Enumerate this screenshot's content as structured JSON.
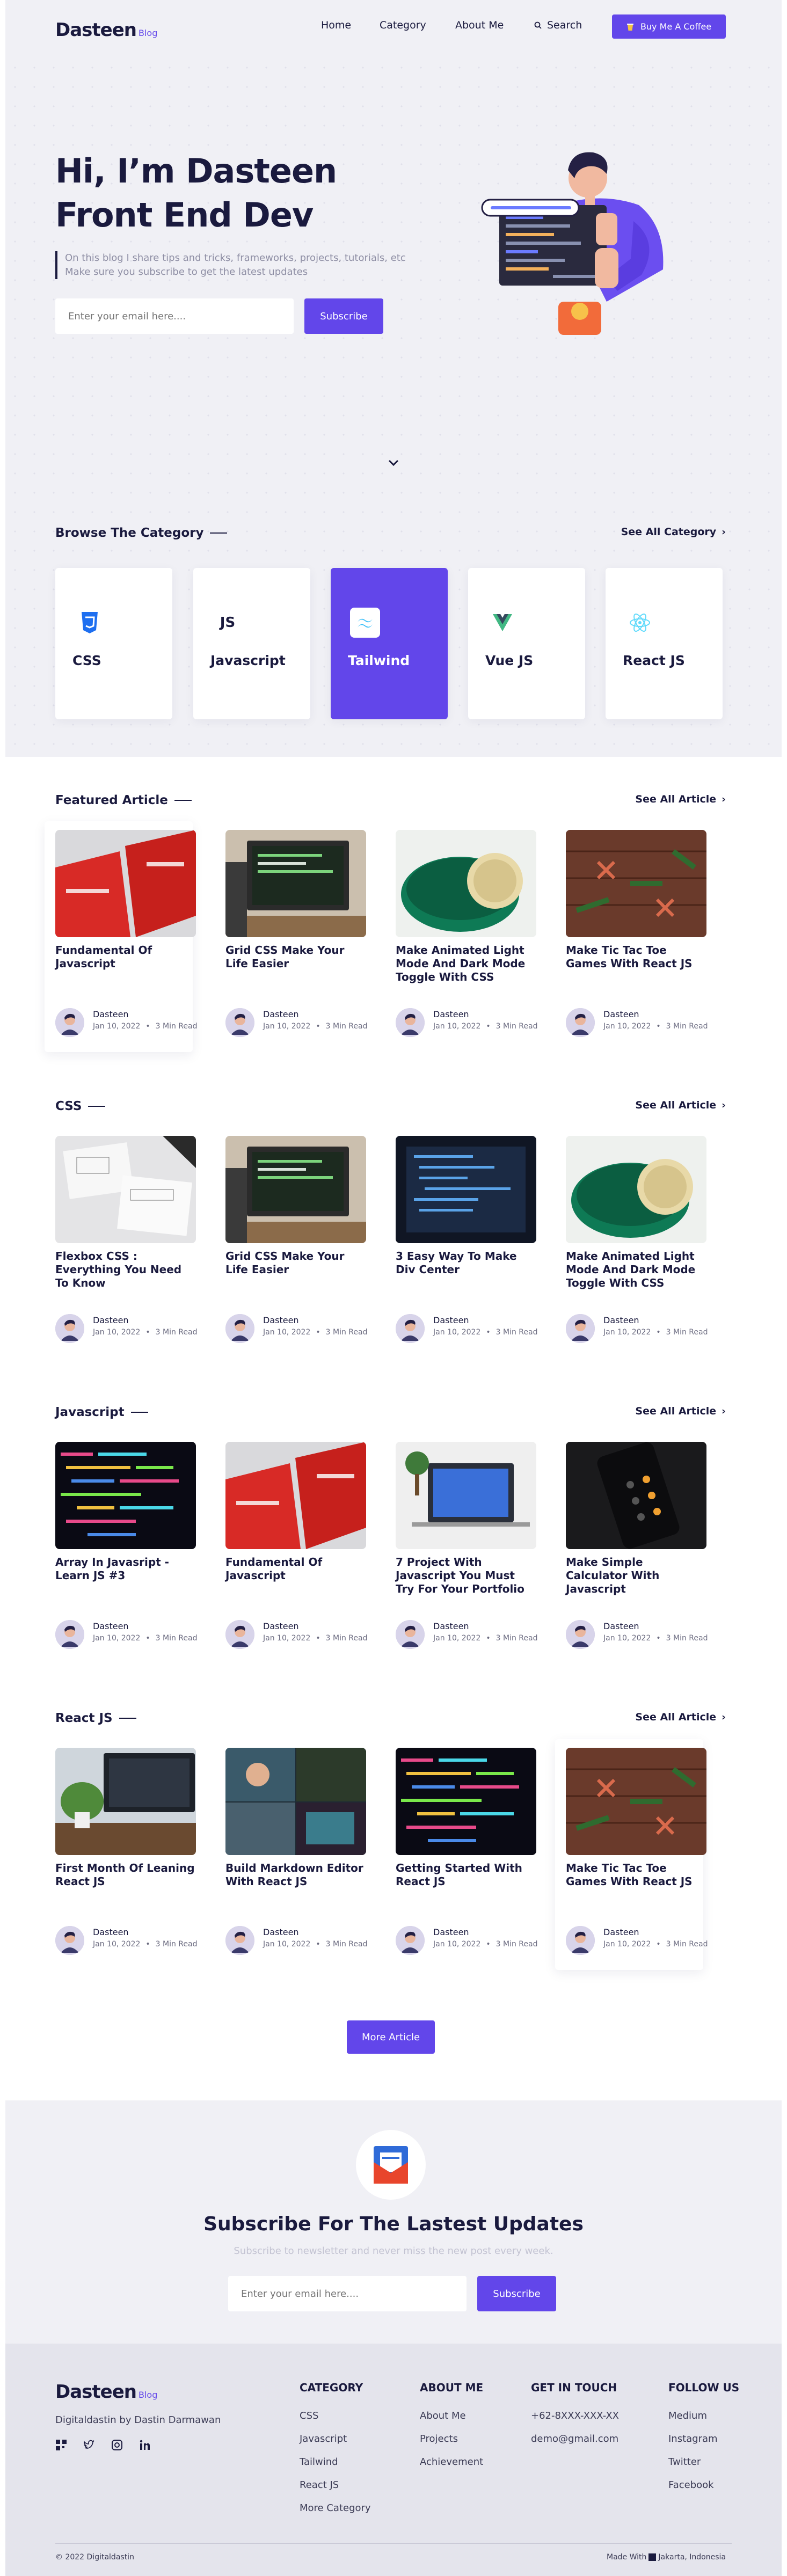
{
  "nav": {
    "logo": "Dasteen",
    "logo_sub": "Blog",
    "home": "Home",
    "category": "Category",
    "about": "About Me",
    "search": "Search",
    "coffee": "Buy Me A Coffee"
  },
  "hero": {
    "line1": "Hi, I’m Dasteen",
    "line2": "Front End Dev",
    "desc1": "On this blog I share tips and tricks, frameworks, projects, tutorials, etc",
    "desc2": "Make sure you subscribe to get the latest updates",
    "email_placeholder": "Enter your email here....",
    "subscribe": "Subscribe"
  },
  "category": {
    "title": "Browse The Category",
    "see_all": "See All Category",
    "items": [
      {
        "label": "CSS",
        "icon": "css3-icon"
      },
      {
        "label": "Javascript",
        "icon": "js-icon"
      },
      {
        "label": "Tailwind",
        "icon": "tailwind-icon",
        "active": true
      },
      {
        "label": "Vue JS",
        "icon": "vue-icon"
      },
      {
        "label": "React JS",
        "icon": "react-icon"
      }
    ]
  },
  "sections": [
    {
      "title": "Featured Article",
      "see_all": "See All Article",
      "cards": [
        {
          "title": "Fundamental Of Javascript",
          "author": "Dasteen",
          "date": "Jan 10, 2022",
          "read": "3 Min Read",
          "img": "red-books"
        },
        {
          "title": "Grid CSS Make Your Life Easier",
          "author": "Dasteen",
          "date": "Jan 10, 2022",
          "read": "3 Min Read",
          "img": "desk-monitor"
        },
        {
          "title": "Make Animated Light Mode And Dark Mode Toggle With CSS",
          "author": "Dasteen",
          "date": "Jan 10, 2022",
          "read": "3 Min Read",
          "img": "toggle"
        },
        {
          "title": "Make Tic Tac Toe Games With React JS",
          "author": "Dasteen",
          "date": "Jan 10, 2022",
          "read": "3 Min Read",
          "img": "tictactoe"
        }
      ]
    },
    {
      "title": "CSS",
      "see_all": "See All Article",
      "cards": [
        {
          "title": "Flexbox CSS : Everything You Need To Know",
          "author": "Dasteen",
          "date": "Jan 10, 2022",
          "read": "3 Min Read",
          "img": "sketch-paper"
        },
        {
          "title": "Grid CSS Make Your Life Easier",
          "author": "Dasteen",
          "date": "Jan 10, 2022",
          "read": "3 Min Read",
          "img": "desk-monitor"
        },
        {
          "title": "3 Easy Way To Make Div Center",
          "author": "Dasteen",
          "date": "Jan 10, 2022",
          "read": "3 Min Read",
          "img": "code-screen"
        },
        {
          "title": "Make Animated Light Mode And Dark Mode Toggle With CSS",
          "author": "Dasteen",
          "date": "Jan 10, 2022",
          "read": "3 Min Read",
          "img": "toggle"
        }
      ]
    },
    {
      "title": "Javascript",
      "see_all": "See All Article",
      "cards": [
        {
          "title": "Array In Javasript - Learn JS #3",
          "author": "Dasteen",
          "date": "Jan 10, 2022",
          "read": "3 Min Read",
          "img": "colorful-code"
        },
        {
          "title": "Fundamental Of Javascript",
          "author": "Dasteen",
          "date": "Jan 10, 2022",
          "read": "3 Min Read",
          "img": "red-books"
        },
        {
          "title": "7 Project With Javascript You Must Try For Your Portfolio",
          "author": "Dasteen",
          "date": "Jan 10, 2022",
          "read": "3 Min Read",
          "img": "workspace"
        },
        {
          "title": "Make Simple Calculator With Javascript",
          "author": "Dasteen",
          "date": "Jan 10, 2022",
          "read": "3 Min Read",
          "img": "calculator"
        }
      ]
    },
    {
      "title": "React JS",
      "see_all": "See All Article",
      "cards": [
        {
          "title": "First Month Of Leaning React JS",
          "author": "Dasteen",
          "date": "Jan 10, 2022",
          "read": "3 Min Read",
          "img": "plant-desk"
        },
        {
          "title": "Build Markdown Editor With React JS",
          "author": "Dasteen",
          "date": "Jan 10, 2022",
          "read": "3 Min Read",
          "img": "collage"
        },
        {
          "title": "Getting Started With React JS",
          "author": "Dasteen",
          "date": "Jan 10, 2022",
          "read": "3 Min Read",
          "img": "colorful-code"
        },
        {
          "title": "Make Tic Tac Toe Games With React JS",
          "author": "Dasteen",
          "date": "Jan 10, 2022",
          "read": "3 Min Read",
          "img": "tictactoe"
        }
      ]
    }
  ],
  "more_article": "More Article",
  "newsletter": {
    "title": "Subscribe For The Lastest Updates",
    "subtitle": "Subscribe to newsletter and never miss the new post every week.",
    "email_placeholder": "Enter your email here....",
    "subscribe": "Subscribe"
  },
  "footer": {
    "logo": "Dasteen",
    "logo_sub": "Blog",
    "tagline": "Digitaldastin by Dastin Darmawan",
    "cols": [
      {
        "title": "CATEGORY",
        "links": [
          "CSS",
          "Javascript",
          "Tailwind",
          "React JS",
          "More Category"
        ]
      },
      {
        "title": "ABOUT ME",
        "links": [
          "About Me",
          "Projects",
          "Achievement"
        ]
      },
      {
        "title": "GET IN TOUCH",
        "links": [
          "+62-8XXX-XXX-XX",
          "demo@gmail.com"
        ]
      },
      {
        "title": "FOLLOW US",
        "links": [
          "Medium",
          "Instagram",
          "Twitter",
          "Facebook"
        ]
      }
    ],
    "copyright": "© 2022 Digitaldastin",
    "made_with": "Made With",
    "location": "Jakarta, Indonesia"
  },
  "colors": {
    "accent": "#6246ea",
    "dark": "#1a1a3e",
    "bg": "#f0f0f5"
  }
}
